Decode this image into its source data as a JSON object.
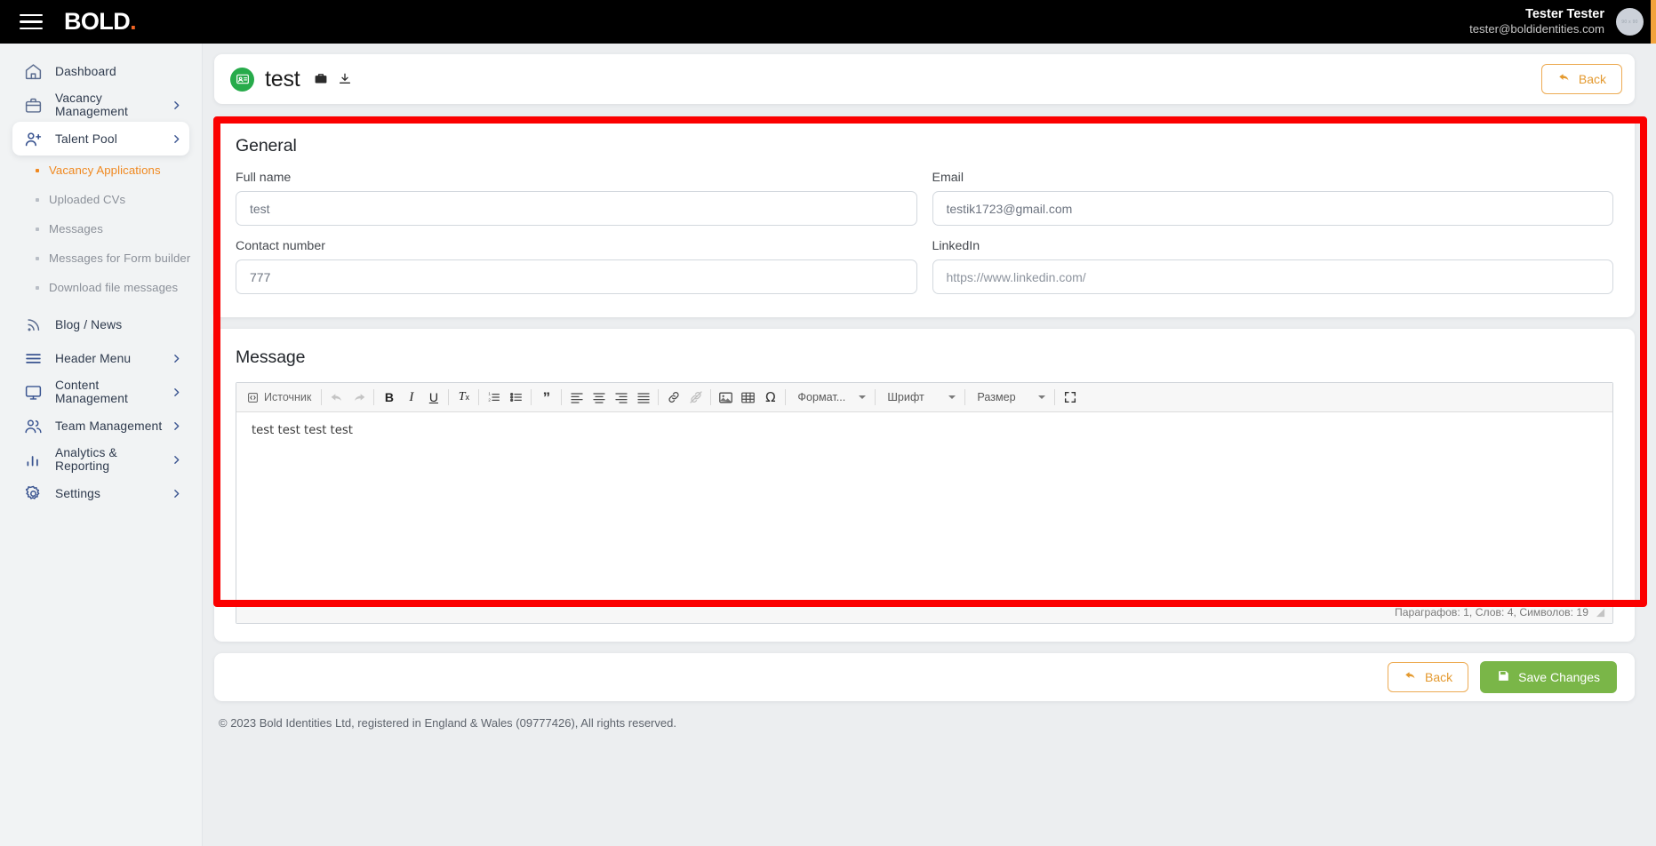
{
  "topbar": {
    "brand": "BOLD",
    "brand_dot": ".",
    "menu_icon": "hamburger-icon",
    "user_name": "Tester Tester",
    "user_email": "tester@boldidentities.com",
    "avatar_placeholder": "90 x 90"
  },
  "sidebar": {
    "items": [
      {
        "label": "Dashboard",
        "icon": "home-icon",
        "chevron": false,
        "active": false
      },
      {
        "label": "Vacancy Management",
        "icon": "briefcase-icon",
        "chevron": true,
        "active": false
      },
      {
        "label": "Talent Pool",
        "icon": "user-plus-icon",
        "chevron": true,
        "active": true
      }
    ],
    "sub_items": [
      {
        "label": "Vacancy Applications",
        "current": true
      },
      {
        "label": "Uploaded CVs",
        "current": false
      },
      {
        "label": "Messages",
        "current": false
      },
      {
        "label": "Messages for Form builder",
        "current": false
      },
      {
        "label": "Download file messages",
        "current": false
      }
    ],
    "items_after": [
      {
        "label": "Blog / News",
        "icon": "rss-icon",
        "chevron": false,
        "active": false
      },
      {
        "label": "Header Menu",
        "icon": "menu-lines-icon",
        "chevron": true,
        "active": false
      },
      {
        "label": "Content Management",
        "icon": "monitor-icon",
        "chevron": true,
        "active": false
      },
      {
        "label": "Team Management",
        "icon": "users-icon",
        "chevron": true,
        "active": false
      },
      {
        "label": "Analytics & Reporting",
        "icon": "bar-chart-icon",
        "chevron": true,
        "active": false
      },
      {
        "label": "Settings",
        "icon": "gear-icon",
        "chevron": true,
        "active": false
      }
    ]
  },
  "header": {
    "title": "test",
    "title_icon": "contact-card-icon",
    "action_icons": [
      "briefcase-icon",
      "download-icon"
    ],
    "back_label": "Back",
    "back_icon": "back-arrow-icon"
  },
  "general": {
    "heading": "General",
    "fields": [
      {
        "label": "Full name",
        "value": "test",
        "placeholder": "Full name",
        "name": "full-name"
      },
      {
        "label": "Email",
        "value": "testik1723@gmail.com",
        "placeholder": "Email",
        "name": "email"
      },
      {
        "label": "Contact number",
        "value": "777",
        "placeholder": "Contact number",
        "name": "contact-number"
      },
      {
        "label": "LinkedIn",
        "value": "",
        "placeholder": "https://www.linkedin.com/",
        "name": "linkedin"
      }
    ]
  },
  "message": {
    "heading": "Message",
    "toolbar": {
      "source_label": "Источник",
      "format_label": "Формат...",
      "font_label": "Шрифт",
      "size_label": "Размер",
      "buttons": [
        "source",
        "undo",
        "redo",
        "bold",
        "italic",
        "underline",
        "remove-format",
        "numbered-list",
        "bulleted-list",
        "blockquote",
        "align-left",
        "align-center",
        "align-right",
        "justify",
        "link",
        "unlink",
        "image",
        "table",
        "special-char",
        "maximize"
      ]
    },
    "body_text": "test test test test",
    "status": "Параграфов: 1, Слов: 4, Символов: 19"
  },
  "actions": {
    "back_label": "Back",
    "save_label": "Save Changes",
    "save_icon": "floppy-disk-icon"
  },
  "footer": {
    "copyright": "© 2023 Bold Identities Ltd, registered in England & Wales (09777426), All rights reserved."
  },
  "colors": {
    "accent_orange": "#f06424",
    "brand_amber": "#e49a30",
    "save_green": "#7ab648",
    "title_green": "#27ab4b",
    "annotation_red": "#fb0000"
  }
}
